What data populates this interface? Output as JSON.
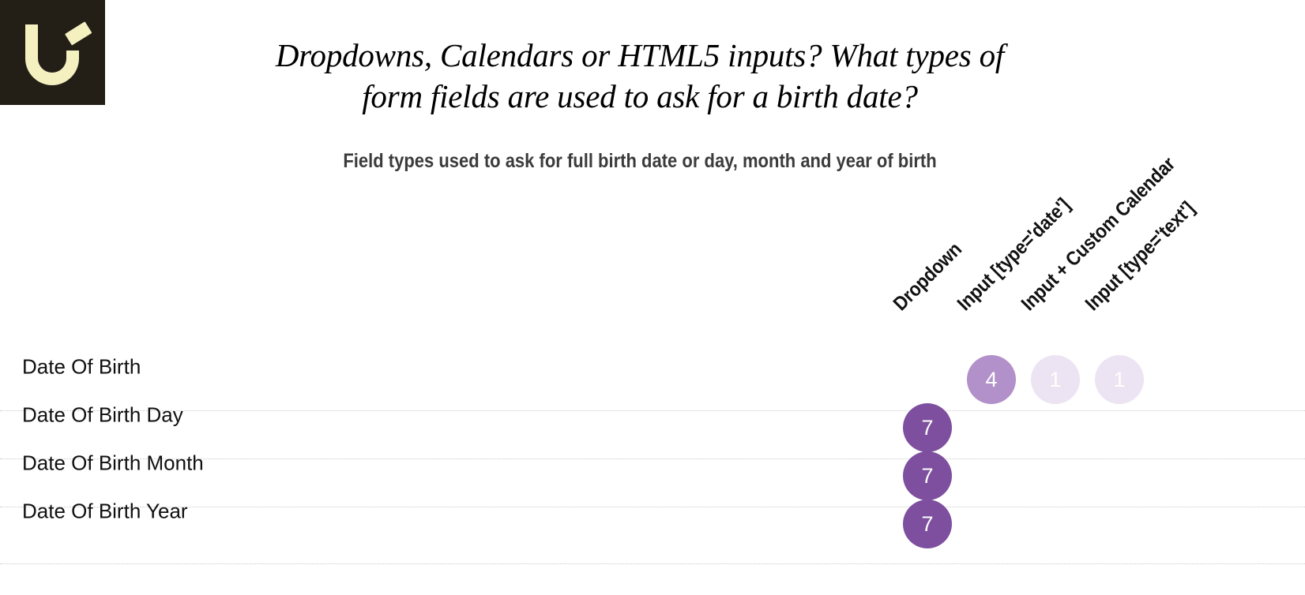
{
  "logo": {
    "name": "brand-logo",
    "background_color": "#231f17",
    "mark_color": "#f5f0c0"
  },
  "header": {
    "title_line_1": "Dropdowns, Calendars or HTML5 inputs? What types of",
    "title_line_2": "form fields are used to ask for a birth date?",
    "subtitle": "Field types used to ask for full birth date or day, month and year of birth"
  },
  "chart_data": {
    "type": "heatmap",
    "title": "Dropdowns, Calendars or HTML5 inputs? What types of form fields are used to ask for a birth date?",
    "subtitle": "Field types used to ask for full birth date or day, month and year of birth",
    "xlabel": "",
    "ylabel": "",
    "legend_position": "none",
    "grid": true,
    "columns": [
      "Dropdown",
      "Input [type='date']",
      "Input + Custom Calendar",
      "Input [type='text']"
    ],
    "rows": [
      "Date Of Birth",
      "Date Of Birth Day",
      "Date Of Birth Month",
      "Date Of Birth Year"
    ],
    "values": [
      [
        null,
        4,
        1,
        1
      ],
      [
        7,
        null,
        null,
        null
      ],
      [
        7,
        null,
        null,
        null
      ],
      [
        7,
        null,
        null,
        null
      ]
    ],
    "value_range": [
      1,
      7
    ],
    "colors": {
      "value_7": "#7d4f9e",
      "value_4": "#b290c9",
      "value_1": "#ece4f2",
      "label_text": "#ffffff"
    }
  },
  "matrix": {
    "column_headers": [
      {
        "label": "Dropdown"
      },
      {
        "label": "Input [type='date']"
      },
      {
        "label": "Input + Custom Calendar"
      },
      {
        "label": "Input [type='text']"
      }
    ],
    "rows": [
      {
        "label": "Date Of Birth",
        "cells": [
          {
            "column": "Dropdown",
            "value": ""
          },
          {
            "column": "Input [type='date']",
            "value": "4"
          },
          {
            "column": "Input + Custom Calendar",
            "value": "1"
          },
          {
            "column": "Input [type='text']",
            "value": "1"
          }
        ]
      },
      {
        "label": "Date Of Birth Day",
        "cells": [
          {
            "column": "Dropdown",
            "value": "7"
          },
          {
            "column": "Input [type='date']",
            "value": ""
          },
          {
            "column": "Input + Custom Calendar",
            "value": ""
          },
          {
            "column": "Input [type='text']",
            "value": ""
          }
        ]
      },
      {
        "label": "Date Of Birth Month",
        "cells": [
          {
            "column": "Dropdown",
            "value": "7"
          },
          {
            "column": "Input [type='date']",
            "value": ""
          },
          {
            "column": "Input + Custom Calendar",
            "value": ""
          },
          {
            "column": "Input [type='text']",
            "value": ""
          }
        ]
      },
      {
        "label": "Date Of Birth Year",
        "cells": [
          {
            "column": "Dropdown",
            "value": "7"
          },
          {
            "column": "Input [type='date']",
            "value": ""
          },
          {
            "column": "Input + Custom Calendar",
            "value": ""
          },
          {
            "column": "Input [type='text']",
            "value": ""
          }
        ]
      }
    ]
  }
}
